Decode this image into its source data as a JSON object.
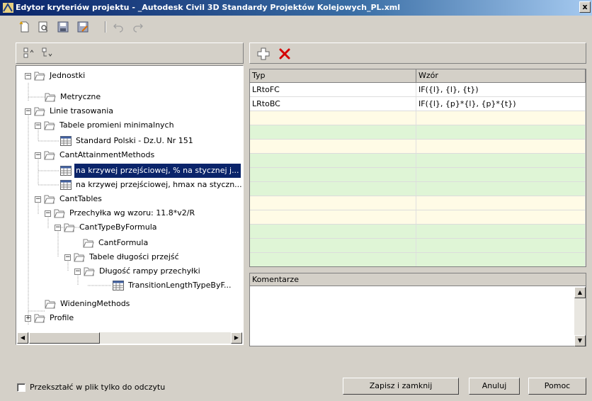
{
  "window": {
    "title": "Edytor kryteriów projektu - _Autodesk Civil 3D Standardy Projektów Kolejowych_PL.xml",
    "close_label": "x"
  },
  "toolbar": {
    "icons": [
      "new-icon",
      "preview-icon",
      "save-icon",
      "save-as-icon",
      "undo-icon",
      "redo-icon"
    ]
  },
  "tree": {
    "rows": [
      {
        "label": "Jednostki",
        "expander": "−"
      },
      {
        "label": "Metryczne"
      },
      {
        "label": "Linie trasowania",
        "expander": "−"
      },
      {
        "label": "Tabele promieni minimalnych",
        "expander": "−"
      },
      {
        "label": "Standard Polski - Dz.U. Nr 151"
      },
      {
        "label": "CantAttainmentMethods",
        "expander": "−"
      },
      {
        "label": "na krzywej przejściowej, % na stycznej j..."
      },
      {
        "label": "na krzywej przejściowej, hmax na styczn..."
      },
      {
        "label": "CantTables",
        "expander": "−"
      },
      {
        "label": "Przechyłka wg wzoru: 11.8*v2/R",
        "expander": "−"
      },
      {
        "label": "CantTypeByFormula",
        "expander": "−"
      },
      {
        "label": "CantFormula"
      },
      {
        "label": "Tabele długości przejść",
        "expander": "−"
      },
      {
        "label": "Długość rampy przechyłki",
        "expander": "−"
      },
      {
        "label": "TransitionLengthTypeByF..."
      },
      {
        "label": "WideningMethods"
      },
      {
        "label": "Profile",
        "expander": "+"
      }
    ]
  },
  "grid": {
    "columns": [
      "Typ",
      "Wzór"
    ],
    "rows": [
      [
        "LRtoFC",
        "IF({l}, {l}, {t})"
      ],
      [
        "LRtoBC",
        "IF({l}, {p}*{l}, {p}*{t})"
      ]
    ]
  },
  "comments": {
    "label": "Komentarze"
  },
  "footer": {
    "readonly_label": "Przekształć w plik tylko do odczytu",
    "save_close_label": "Zapisz i zamknij",
    "cancel_label": "Anuluj",
    "help_label": "Pomoc"
  },
  "colors": {
    "selection": "#0a246a",
    "row_yellow": "#fffbe6",
    "row_green": "#dff5d6",
    "delete_red": "#d40000"
  }
}
